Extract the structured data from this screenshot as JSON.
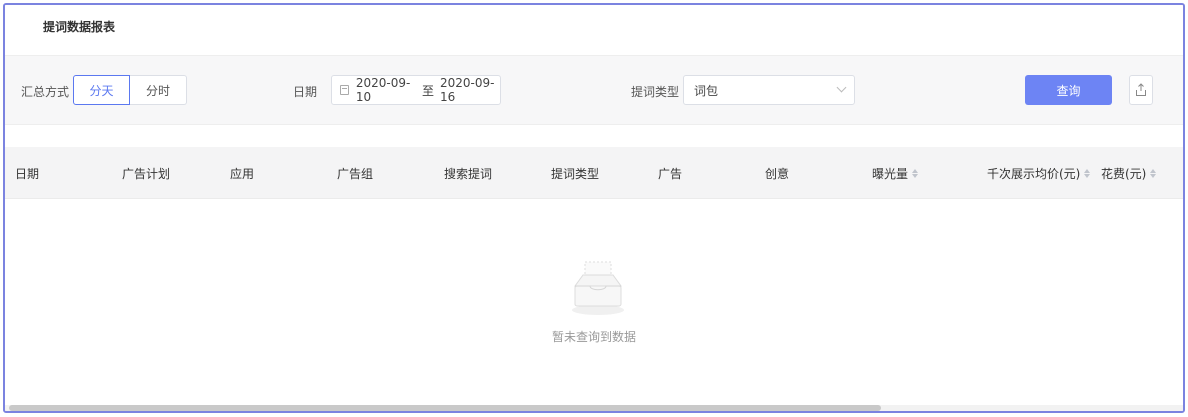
{
  "page": {
    "title": "提词数据报表"
  },
  "filters": {
    "aggregate_label": "汇总方式",
    "aggregate_options": [
      {
        "label": "分天",
        "active": true
      },
      {
        "label": "分时",
        "active": false
      }
    ],
    "date_label": "日期",
    "date_start": "2020-09-10",
    "date_sep": "至",
    "date_end": "2020-09-16",
    "type_label": "提词类型",
    "type_value": "词包",
    "query_label": "查询"
  },
  "table": {
    "columns": [
      {
        "label": "日期",
        "sortable": false
      },
      {
        "label": "广告计划",
        "sortable": false
      },
      {
        "label": "应用",
        "sortable": false
      },
      {
        "label": "广告组",
        "sortable": false
      },
      {
        "label": "搜索提词",
        "sortable": false
      },
      {
        "label": "提词类型",
        "sortable": false
      },
      {
        "label": "广告",
        "sortable": false
      },
      {
        "label": "创意",
        "sortable": false
      },
      {
        "label": "曝光量",
        "sortable": true
      },
      {
        "label": "千次展示均价(元)",
        "sortable": true
      },
      {
        "label": "花费(元)",
        "sortable": true
      }
    ],
    "rows": [],
    "empty_text": "暂未查询到数据"
  },
  "colors": {
    "accent": "#6d84f4",
    "frame_border": "#7b83e0"
  },
  "icons": {
    "calendar": "calendar-icon",
    "select": "chevron-down-icon",
    "export": "export-icon",
    "empty": "empty-box-icon"
  }
}
